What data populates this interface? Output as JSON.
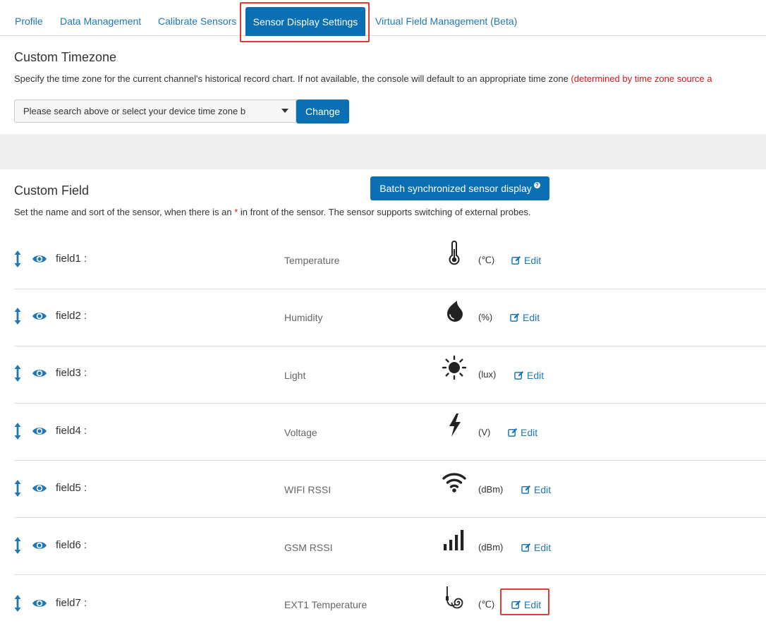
{
  "tabs": [
    {
      "label": "Profile"
    },
    {
      "label": "Data Management"
    },
    {
      "label": "Calibrate Sensors"
    },
    {
      "label": "Sensor Display Settings",
      "active": true
    },
    {
      "label": "Virtual Field Management (Beta)"
    }
  ],
  "timezone": {
    "title": "Custom Timezone",
    "description": "Specify the time zone for the current channel's historical record chart. If not available, the console will default to an appropriate time zone",
    "description_red": "(determined by time zone source a",
    "select_text": "Please search above or select your device time zone b",
    "change_label": "Change"
  },
  "custom_field": {
    "title": "Custom Field",
    "batch_button_label": "Batch synchronized sensor display",
    "help_glyph": "?",
    "description_prefix": "Set the name and sort of the sensor, when there is an ",
    "description_star": "*",
    "description_suffix": " in front of the sensor. The sensor supports switching of external probes."
  },
  "edit_label": "Edit",
  "fields": [
    {
      "name": "field1  :",
      "sensor": "Temperature",
      "icon": "thermometer-icon",
      "unit": "(℃)"
    },
    {
      "name": "field2  :",
      "sensor": "Humidity",
      "icon": "water-drop-icon",
      "unit": "(%)"
    },
    {
      "name": "field3  :",
      "sensor": "Light",
      "icon": "sun-icon",
      "unit": "(lux)"
    },
    {
      "name": "field4  :",
      "sensor": "Voltage",
      "icon": "lightning-bolt-icon",
      "unit": "(V)"
    },
    {
      "name": "field5  :",
      "sensor": "WIFI RSSI",
      "icon": "wifi-icon",
      "unit": "(dBm)"
    },
    {
      "name": "field6  :",
      "sensor": "GSM RSSI",
      "icon": "signal-bars-icon",
      "unit": "(dBm)"
    },
    {
      "name": "field7  :",
      "sensor": "EXT1 Temperature",
      "icon": "probe-icon",
      "unit": "(℃)"
    }
  ],
  "colors": {
    "accent": "#0a6fb3",
    "link": "#1f78b4",
    "highlight": "#e53935",
    "warning_text": "#e0161b"
  }
}
